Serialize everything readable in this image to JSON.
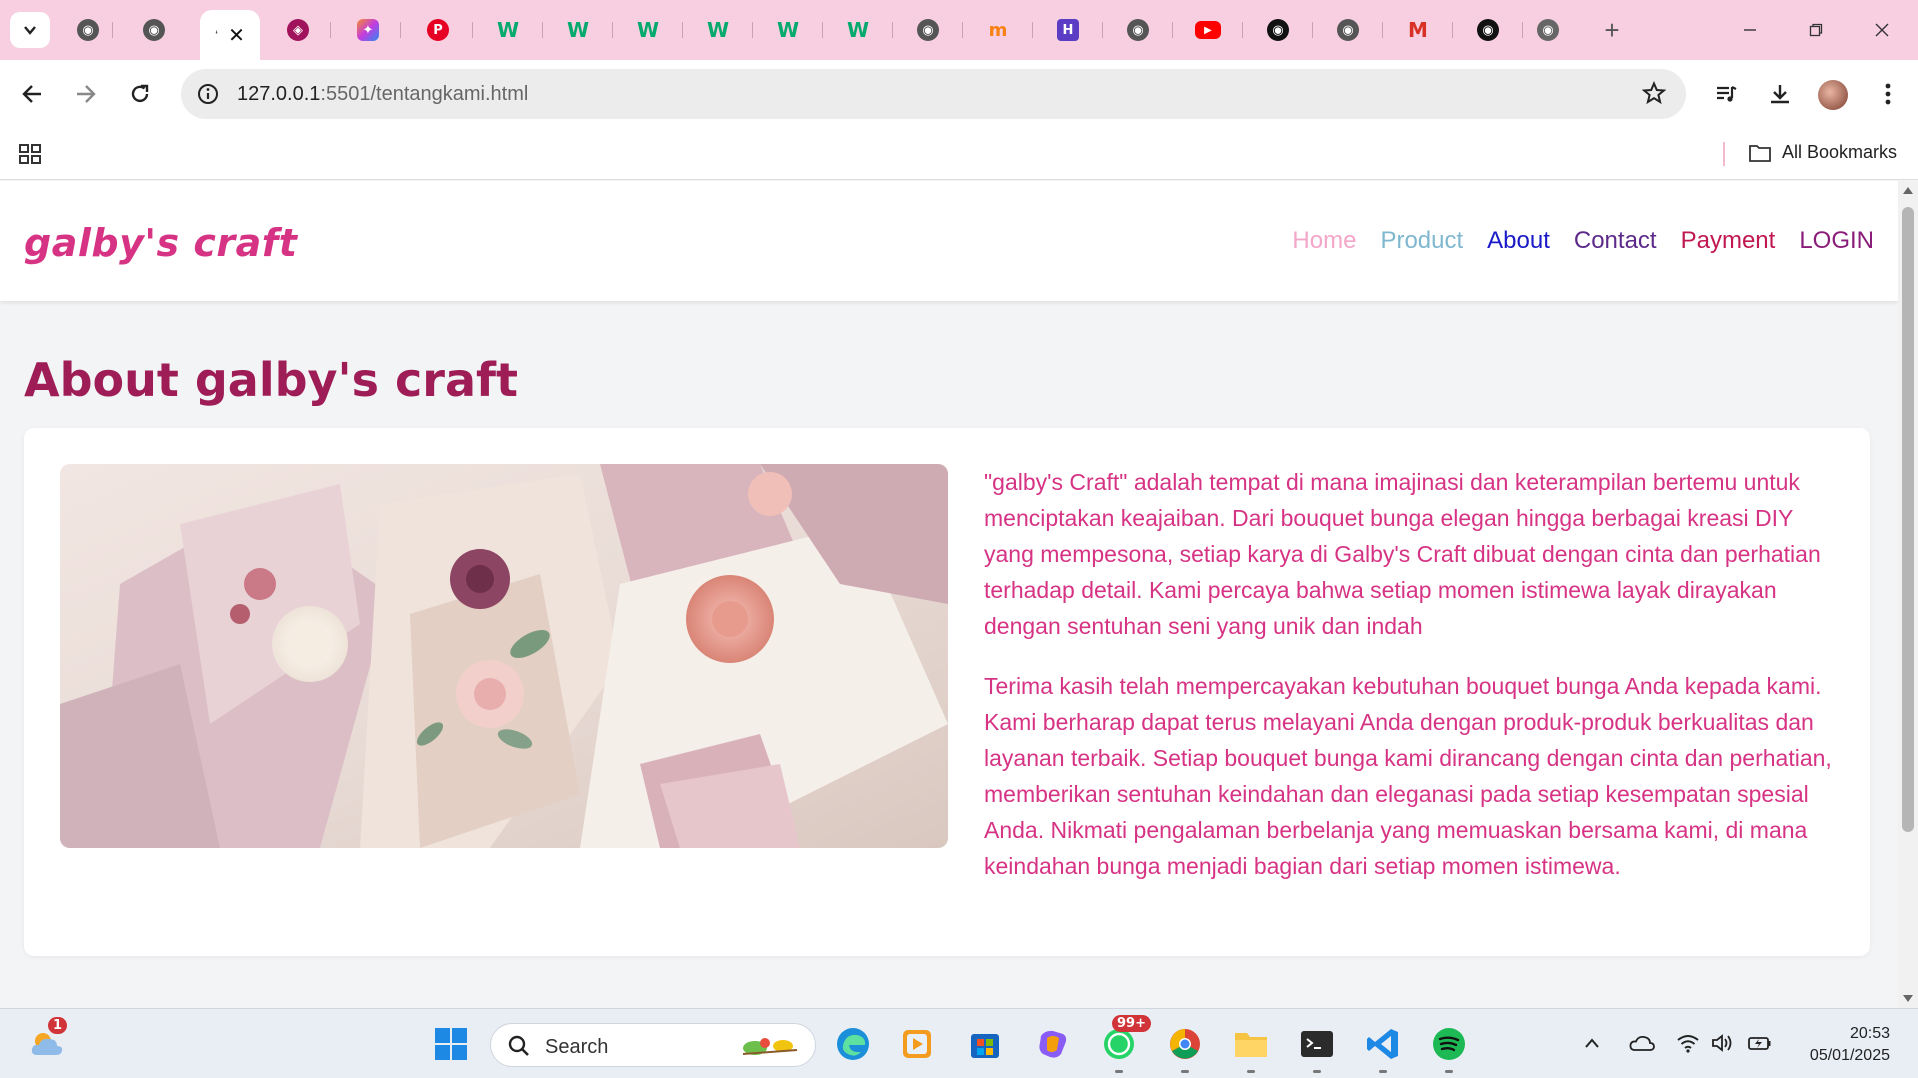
{
  "browser": {
    "tabs": [
      {
        "icon": "globe-icon"
      },
      {
        "icon": "globe-icon"
      },
      {
        "icon": "loading-icon",
        "active": true
      },
      {
        "icon": "brain-icon"
      },
      {
        "icon": "copilot-icon"
      },
      {
        "icon": "pinterest-icon"
      },
      {
        "icon": "w3schools-icon"
      },
      {
        "icon": "w3schools-icon"
      },
      {
        "icon": "w3schools-icon"
      },
      {
        "icon": "w3schools-icon"
      },
      {
        "icon": "w3schools-icon"
      },
      {
        "icon": "w3schools-icon"
      },
      {
        "icon": "globe-icon"
      },
      {
        "icon": "moodle-icon"
      },
      {
        "icon": "hub-icon"
      },
      {
        "icon": "globe-icon"
      },
      {
        "icon": "youtube-icon"
      },
      {
        "icon": "github-icon"
      },
      {
        "icon": "globe-icon"
      },
      {
        "icon": "gmail-icon"
      },
      {
        "icon": "github-icon"
      },
      {
        "icon": "chrome-icon"
      }
    ],
    "address": {
      "host": "127.0.0.1",
      "rest": ":5501/tentangkami.html"
    },
    "bookmarks": {
      "all_label": "All Bookmarks"
    },
    "tab_strip_color": "#f7cfe0"
  },
  "site": {
    "logo": "galby's craft",
    "nav": [
      {
        "label": "Home",
        "color": "#f4a6c8"
      },
      {
        "label": "Product",
        "color": "#7fb7cf"
      },
      {
        "label": "About",
        "color": "#1a1ac8"
      },
      {
        "label": "Contact",
        "color": "#5c2a8a"
      },
      {
        "label": "Payment",
        "color": "#c0184f"
      },
      {
        "label": "LOGIN",
        "color": "#8a1d7a"
      }
    ],
    "page_title": "About galby's craft",
    "paragraphs": [
      "\"galby's Craft\" adalah tempat di mana imajinasi dan keterampilan bertemu untuk menciptakan keajaiban. Dari bouquet bunga elegan hingga berbagai kreasi DIY yang mempesona, setiap karya di Galby's Craft dibuat dengan cinta dan perhatian terhadap detail. Kami percaya bahwa setiap momen istimewa layak dirayakan dengan sentuhan seni yang unik dan indah",
      "Terima kasih telah mempercayakan kebutuhan bouquet bunga Anda kepada kami. Kami berharap dapat terus melayani Anda dengan produk-produk berkualitas dan layanan terbaik. Setiap bouquet bunga kami dirancang dengan cinta dan perhatian, memberikan sentuhan keindahan dan eleganasi pada setiap kesempatan spesial Anda. Nikmati pengalaman berbelanja yang memuaskan bersama kami, di mana keindahan bunga menjadi bagian dari setiap momen istimewa."
    ],
    "accent_color": "#d63384",
    "title_color": "#9e1d57"
  },
  "taskbar": {
    "search_label": "Search",
    "weather_badge": "1",
    "whatsapp_badge": "99+",
    "time": "20:53",
    "date": "05/01/2025"
  }
}
